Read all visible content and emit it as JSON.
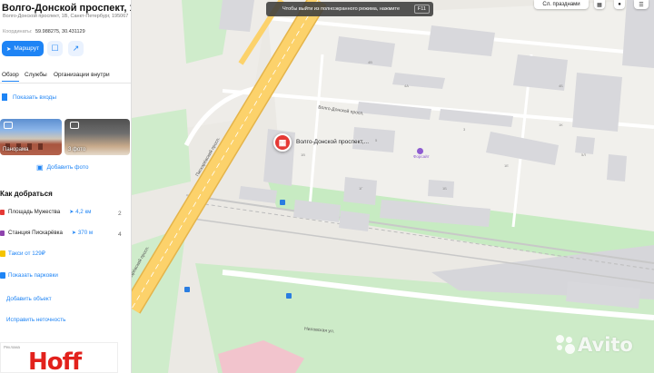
{
  "panel": {
    "title": "Волго-Донской проспект, 1В",
    "address": "Волго-Донской проспект, 1В, Санкт-Петербург, 195067",
    "coords_label": "Координаты:",
    "coords": "59.988275, 30.431129",
    "route_label": "Маршрут",
    "tabs": [
      "Обзор",
      "Службы",
      "Организации внутри"
    ],
    "show_entrances": "Показать входы",
    "panorama_label": "Панорама",
    "photos_label": "3 фото",
    "add_photo": "Добавить фото",
    "how_to_get": "Как добраться",
    "metro": [
      {
        "name": "Площадь Мужества",
        "walk": "4,2 км",
        "num": "2"
      },
      {
        "name": "Станция Пискарёвка",
        "walk": "370 м",
        "num": "4"
      }
    ],
    "taxi": "Такси от 129₽",
    "parking": "Показать парковки",
    "add_object": "Добавить объект",
    "fix_info": "Исправить неточность",
    "ad_logo": "Hoff",
    "ad_small": "Реклама"
  },
  "map": {
    "fullscreen_banner": "Чтобы выйти из полноэкранного режима, нажмите",
    "fullscreen_key": "F11",
    "top_buttons": [
      "Сл. празднами"
    ],
    "poi_label": "Волго-Донской проспект,...",
    "street_labels": [
      "Волго-Донской просп.",
      "Пискарёвский просп.",
      "Пискарёвский просп.",
      "Ниловская ул."
    ],
    "building_numbers": [
      "4В",
      "4А",
      "4Б",
      "5",
      "1В",
      "1Г",
      "1Б",
      "1К",
      "1Е",
      "5Л",
      "3"
    ],
    "forsite_label": "Форсайт",
    "watermark": "Avito",
    "colors": {
      "road_main": "#fcd26b",
      "road_outline": "#e4b44a",
      "park": "#c9ebc4",
      "block": "#eeece8",
      "building": "#d8d8dc",
      "rail": "#bdbdbd"
    }
  }
}
